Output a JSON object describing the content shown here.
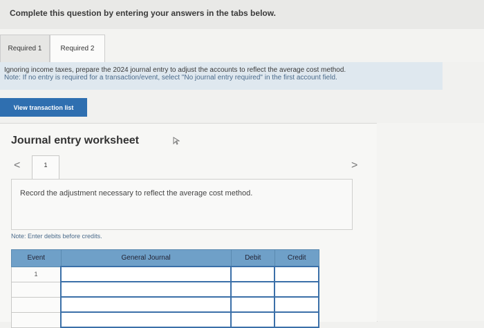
{
  "header": {
    "title": "Complete this question by entering your answers in the tabs below."
  },
  "tabs": [
    {
      "label": "Required 1"
    },
    {
      "label": "Required 2"
    }
  ],
  "instructions": {
    "main": "Ignoring income taxes, prepare the 2024 journal entry to adjust the accounts to reflect the average cost method.",
    "note": "Note: If no entry is required for a transaction/event, select \"No journal entry required\" in the first account field."
  },
  "buttons": {
    "view_transaction_list": "View transaction list"
  },
  "worksheet": {
    "title": "Journal entry worksheet",
    "page_number": "1",
    "prev_symbol": "<",
    "next_symbol": ">",
    "description": "Record the adjustment necessary to reflect the average cost method.",
    "note": "Note: Enter debits before credits."
  },
  "journal_table": {
    "headers": [
      "Event",
      "General Journal",
      "Debit",
      "Credit"
    ],
    "rows": [
      {
        "event": "1"
      },
      {
        "event": ""
      },
      {
        "event": ""
      },
      {
        "event": ""
      }
    ]
  },
  "colors": {
    "button_blue": "#2f6fb0",
    "header_blue": "#6fa0c8",
    "instruction_bg": "#dfe8ef"
  }
}
